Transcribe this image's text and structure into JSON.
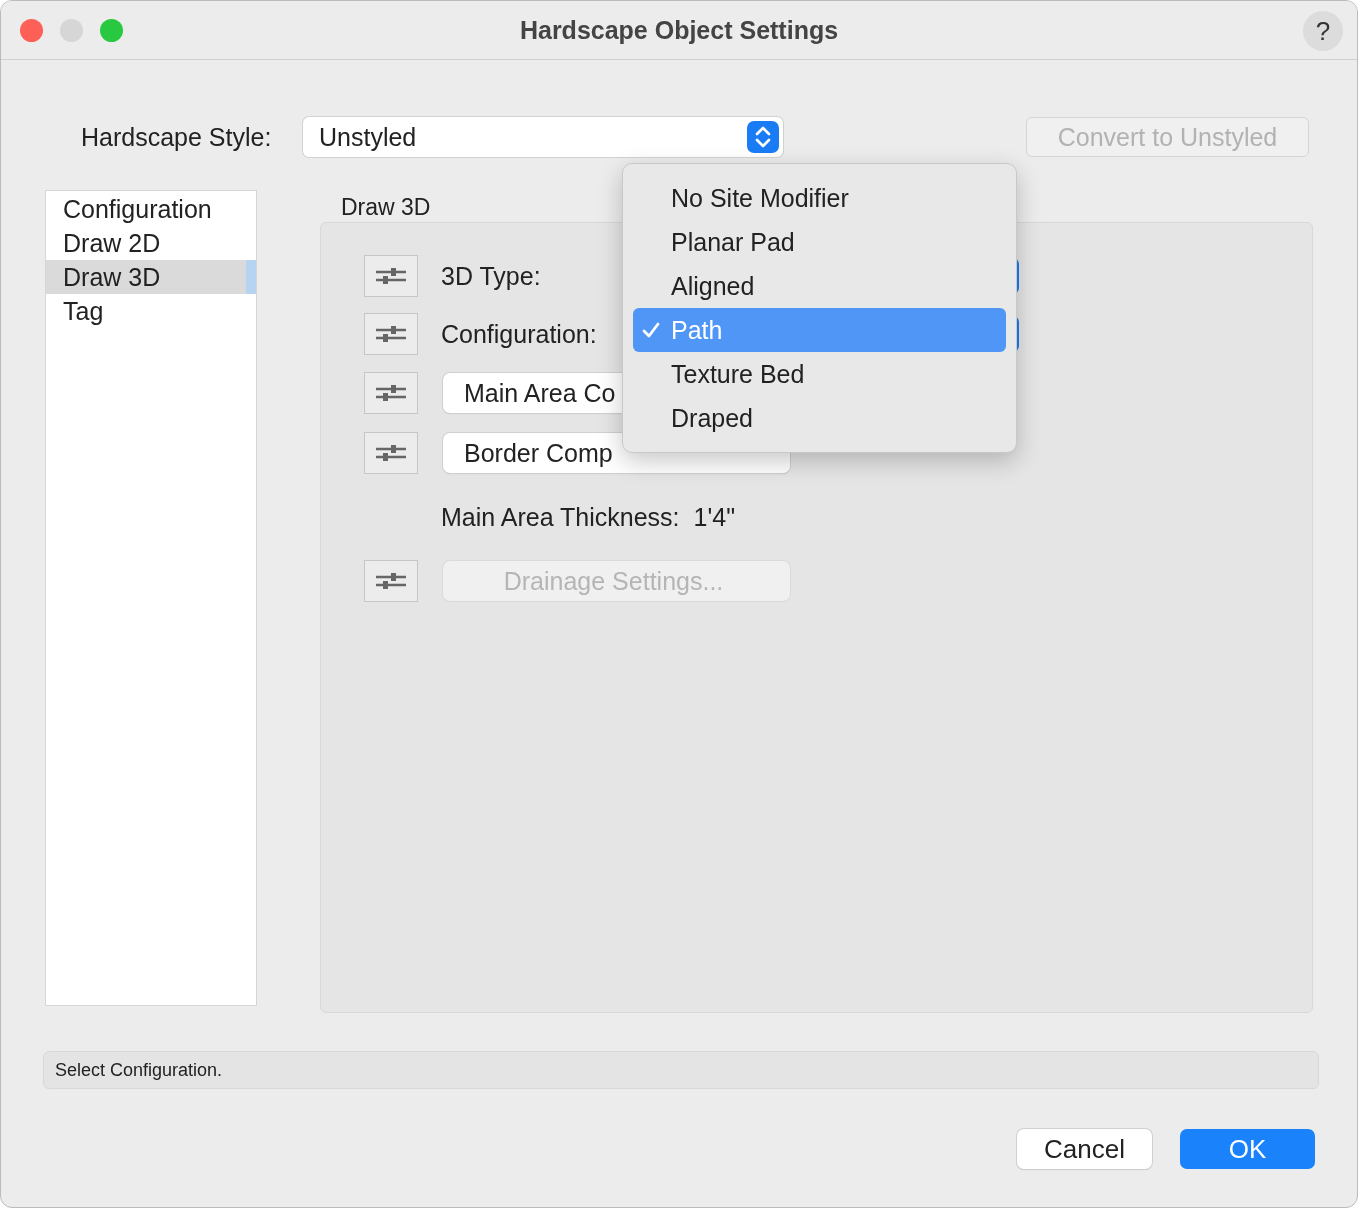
{
  "window": {
    "title": "Hardscape Object Settings",
    "help": "?"
  },
  "style_field": {
    "label": "Hardscape Style:",
    "value": "Unstyled"
  },
  "convert_button": {
    "label": "Convert to Unstyled",
    "disabled": true
  },
  "sidebar": {
    "items": [
      {
        "label": "Configuration",
        "selected": false
      },
      {
        "label": "Draw 2D",
        "selected": false
      },
      {
        "label": "Draw 3D",
        "selected": true
      },
      {
        "label": "Tag",
        "selected": false
      }
    ]
  },
  "section": {
    "title": "Draw 3D",
    "rows": [
      {
        "kind": "select",
        "label": "3D Type:"
      },
      {
        "kind": "select",
        "label": "Configuration:"
      },
      {
        "kind": "button",
        "label": "Main Area Co",
        "disabled": false
      },
      {
        "kind": "button",
        "label": "Border Comp",
        "disabled": false
      },
      {
        "kind": "text",
        "label": "Main Area Thickness:",
        "value": "1'4\""
      },
      {
        "kind": "button",
        "label": "Drainage Settings...",
        "disabled": true
      }
    ]
  },
  "menu": {
    "items": [
      {
        "label": "No Site Modifier",
        "selected": false
      },
      {
        "label": "Planar Pad",
        "selected": false
      },
      {
        "label": "Aligned",
        "selected": false
      },
      {
        "label": "Path",
        "selected": true
      },
      {
        "label": "Texture Bed",
        "selected": false
      },
      {
        "label": "Draped",
        "selected": false
      }
    ]
  },
  "status_bar": "Select Configuration.",
  "buttons": [
    {
      "label": "Cancel",
      "default": false
    },
    {
      "label": "OK",
      "default": true
    }
  ]
}
